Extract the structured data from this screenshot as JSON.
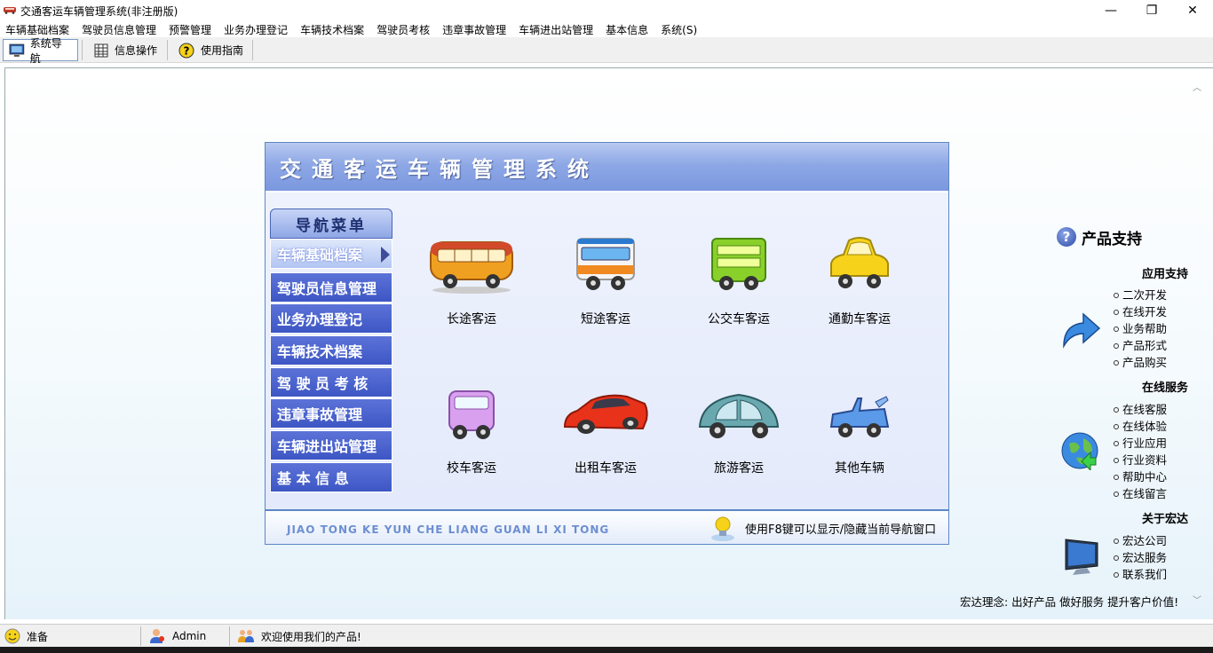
{
  "window": {
    "title": "交通客运车辆管理系统(非注册版)",
    "min": "—",
    "max": "❐",
    "close": "✕"
  },
  "menu": [
    "车辆基础档案",
    "驾驶员信息管理",
    "预警管理",
    "业务办理登记",
    "车辆技术档案",
    "驾驶员考核",
    "违章事故管理",
    "车辆进出站管理",
    "基本信息",
    "系统(S)"
  ],
  "toolbar": [
    {
      "label": "系统导航",
      "icon": "monitor-icon"
    },
    {
      "label": "信息操作",
      "icon": "grid-icon"
    },
    {
      "label": "使用指南",
      "icon": "help-icon"
    }
  ],
  "panel": {
    "title": "交通客运车辆管理系统",
    "nav_header": "导航菜单",
    "nav_items": [
      "车辆基础档案",
      "驾驶员信息管理",
      "业务办理登记",
      "车辆技术档案",
      "驾 驶 员 考 核",
      "违章事故管理",
      "车辆进出站管理",
      "基 本 信 息"
    ],
    "vehicles": [
      "长途客运",
      "短途客运",
      "公交车客运",
      "通勤车客运",
      "校车客运",
      "出租车客运",
      "旅游客运",
      "其他车辆"
    ],
    "footer_en": "JIAO TONG KE YUN CHE LIANG GUAN LI XI TONG",
    "footer_tip": "使用F8键可以显示/隐藏当前导航窗口"
  },
  "support": {
    "title": "产品支持",
    "sections": [
      {
        "heading": "应用支持",
        "links": [
          "二次开发",
          "在线开发",
          "业务帮助",
          "产品形式",
          "产品购买"
        ]
      },
      {
        "heading": "在线服务",
        "links": [
          "在线客服",
          "在线体验",
          "行业应用",
          "行业资料",
          "帮助中心",
          "在线留言"
        ]
      },
      {
        "heading": "关于宏达",
        "links": [
          "宏达公司",
          "宏达服务",
          "联系我们"
        ]
      }
    ],
    "motto": "宏达理念: 出好产品  做好服务  提升客户价值!"
  },
  "status": {
    "ready": "准备",
    "user": "Admin",
    "welcome": "欢迎使用我们的产品!"
  },
  "colors": {
    "nav_blue": "#3e56c4",
    "header_blue": "#8ea8e6",
    "border": "#5b86c6"
  }
}
